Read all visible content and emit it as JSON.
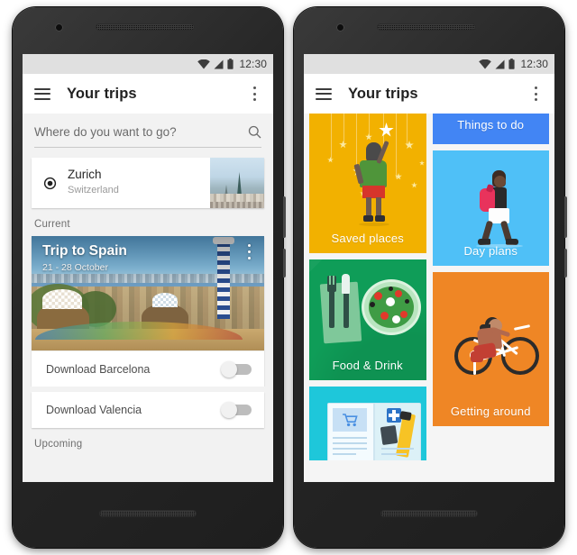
{
  "status_bar": {
    "time": "12:30",
    "icons": [
      "wifi-icon",
      "signal-icon",
      "battery-icon"
    ]
  },
  "app_bar": {
    "menu_icon": "hamburger-menu-icon",
    "title": "Your trips",
    "overflow_icon": "overflow-menu-icon"
  },
  "left_phone": {
    "search": {
      "placeholder": "Where do you want to go?",
      "icon": "search-icon"
    },
    "suggestion": {
      "icon": "gps-location-icon",
      "title": "Zurich",
      "subtitle": "Switzerland"
    },
    "sections": {
      "current": "Current",
      "upcoming": "Upcoming"
    },
    "trip_card": {
      "title": "Trip to Spain",
      "dates": "21 - 28 October",
      "overflow_icon": "overflow-menu-icon"
    },
    "downloads": [
      {
        "label": "Download Barcelona",
        "state": "off"
      },
      {
        "label": "Download Valencia",
        "state": "off"
      }
    ]
  },
  "right_phone": {
    "tiles": [
      {
        "label": "Saved places",
        "color": "#f2b100",
        "art": "girl-reaching-stars-illustration"
      },
      {
        "label": "Things to do",
        "color": "#4285f4",
        "art": "none"
      },
      {
        "label": "Day plans",
        "color": "#4fc0f7",
        "art": "walking-backpacker-illustration"
      },
      {
        "label": "Food & Drink",
        "color": "#0f9d58",
        "art": "salad-plate-cutlery-illustration"
      },
      {
        "label": "Getting around",
        "color": "#ef8625",
        "art": "cyclist-illustration"
      },
      {
        "label": "",
        "color": "#1ec7da",
        "art": "open-guidebook-illustration"
      }
    ]
  },
  "nav_bar": {
    "back": "back-button",
    "home": "home-button",
    "recents": "recents-button"
  },
  "colors": {
    "accent_blue": "#4285f4",
    "yellow": "#f2b100",
    "light_blue": "#4fc0f7",
    "green": "#0f9d58",
    "orange": "#ef8625",
    "cyan": "#1ec7da",
    "status_bar_bg": "#e0e0e0",
    "page_bg": "#f2f2f2"
  }
}
